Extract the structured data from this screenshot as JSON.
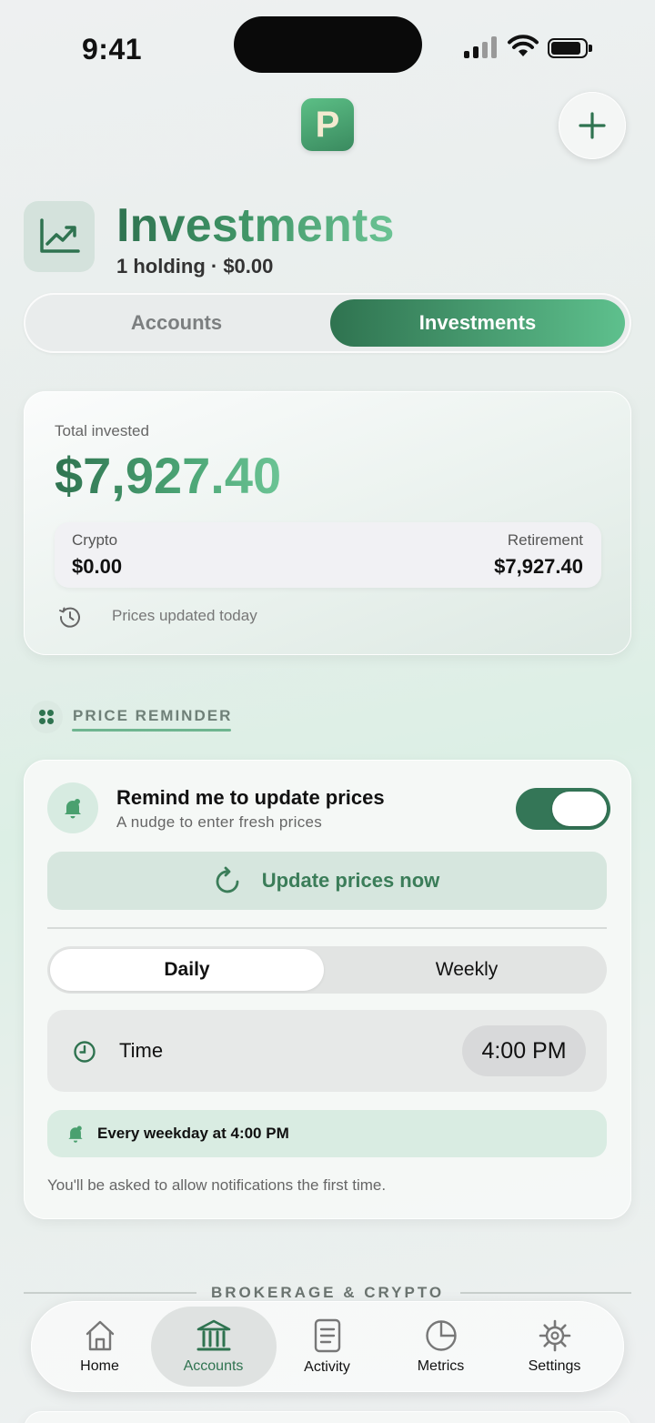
{
  "status_bar": {
    "time": "9:41"
  },
  "header": {
    "title": "Investments",
    "subtitle": "1 holding · $0.00",
    "add_icon": "plus-icon",
    "logo_letter": "P"
  },
  "segmented": {
    "left_label": "Accounts",
    "right_label": "Investments",
    "selected": "Investments"
  },
  "total_card": {
    "label": "Total invested",
    "value": "$7,927.40",
    "crypto_label": "Crypto",
    "crypto_value": "$0.00",
    "retirement_label": "Retirement",
    "retirement_value": "$7,927.40",
    "updated_text": "Prices updated today"
  },
  "price_reminder": {
    "section_title": "PRICE REMINDER",
    "title": "Remind me to update prices",
    "subtitle": "A nudge to enter fresh prices",
    "toggle_on": true,
    "update_button": "Update prices now",
    "frequency_options": [
      "Daily",
      "Weekly"
    ],
    "frequency_selected": "Daily",
    "time_label": "Time",
    "time_value": "4:00 PM",
    "schedule_text": "Every weekday at 4:00 PM",
    "note": "You'll be asked to allow notifications the first time."
  },
  "brokerage_section": {
    "title": "BROKERAGE & CRYPTO"
  },
  "tab_bar": {
    "items": [
      {
        "label": "Home",
        "icon": "home-icon"
      },
      {
        "label": "Accounts",
        "icon": "bank-icon"
      },
      {
        "label": "Activity",
        "icon": "document-icon"
      },
      {
        "label": "Metrics",
        "icon": "pie-chart-icon"
      },
      {
        "label": "Settings",
        "icon": "gear-icon"
      }
    ],
    "selected": "Accounts"
  },
  "colors": {
    "accent": "#2f7350",
    "accent_light": "#5ec08d",
    "toggle": "#347657"
  }
}
